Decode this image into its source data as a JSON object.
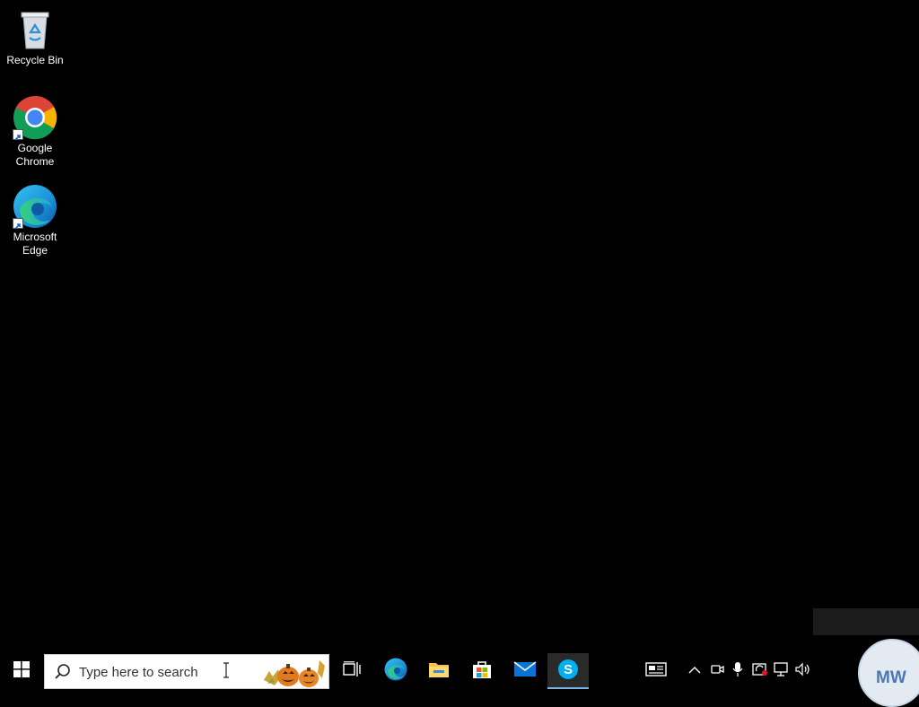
{
  "desktop": {
    "icons": [
      {
        "label": "Recycle Bin",
        "icon": "recycle-bin-icon"
      },
      {
        "label": "Google\nChrome",
        "icon": "chrome-icon"
      },
      {
        "label": "Microsoft\nEdge",
        "icon": "edge-icon"
      }
    ]
  },
  "taskbar": {
    "start_icon": "windows-logo-icon",
    "search": {
      "placeholder": "Type here to search"
    },
    "pinned": [
      {
        "name": "task-view",
        "icon": "task-view-icon"
      },
      {
        "name": "edge",
        "icon": "edge-icon"
      },
      {
        "name": "file-explorer",
        "icon": "folder-icon"
      },
      {
        "name": "microsoft-store",
        "icon": "store-icon"
      },
      {
        "name": "mail",
        "icon": "mail-icon"
      },
      {
        "name": "skype",
        "icon": "skype-icon",
        "active": true
      }
    ],
    "tray": {
      "news": "news-icon",
      "chevron": "chevron-up-icon",
      "meet_now": "meet-now-icon",
      "microphone": "microphone-icon",
      "sync": "sync-icon",
      "network": "network-icon",
      "volume": "volume-icon"
    }
  },
  "user": {
    "initials": "MW"
  },
  "colors": {
    "accent": "#0078d7",
    "skype": "#00aff0",
    "mail": "#0a74d6"
  }
}
